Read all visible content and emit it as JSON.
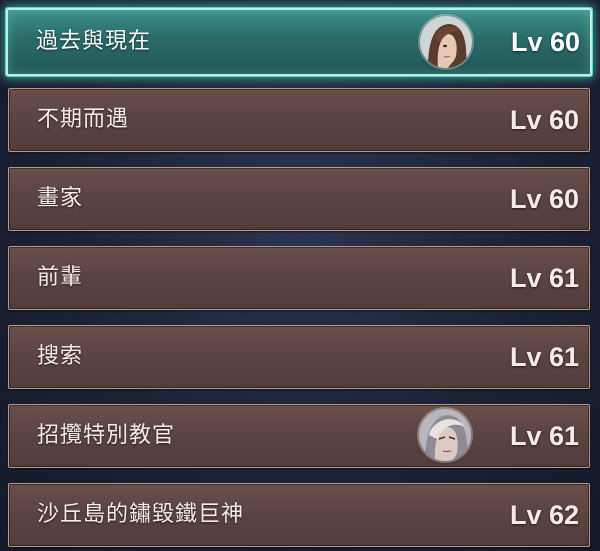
{
  "quests": [
    {
      "title": "過去與現在",
      "level": "Lv 60",
      "selected": true,
      "portrait": "woman-portrait-icon"
    },
    {
      "title": "不期而遇",
      "level": "Lv 60"
    },
    {
      "title": "畫家",
      "level": "Lv 60"
    },
    {
      "title": "前輩",
      "level": "Lv 61"
    },
    {
      "title": "搜索",
      "level": "Lv 61"
    },
    {
      "title": "招攬特別教官",
      "level": "Lv 61",
      "portrait": "man-portrait-icon"
    },
    {
      "title": "沙丘島的鏽毀鐵巨神",
      "level": "Lv 62"
    }
  ],
  "colors": {
    "row_bg": "#5c4442",
    "row_border": "#b49a88",
    "selected_bg": "#2a6c6a",
    "selected_glow": "#4fd8c6",
    "background": "#1c2236"
  }
}
